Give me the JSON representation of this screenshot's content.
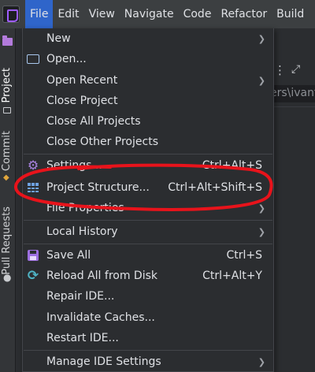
{
  "menubar": {
    "items": [
      "File",
      "Edit",
      "View",
      "Navigate",
      "Code",
      "Refactor",
      "Build"
    ]
  },
  "toolstrip": {
    "project_label": "Project",
    "commit_label": "Commit",
    "pull_requests_label": "Pull Requests"
  },
  "background": {
    "path_fragment": "ers\\ivanf"
  },
  "file_menu": {
    "new": {
      "label": "New",
      "has_submenu": true
    },
    "open": {
      "label": "Open..."
    },
    "open_recent": {
      "label": "Open Recent",
      "has_submenu": true
    },
    "close_project": {
      "label": "Close Project"
    },
    "close_all_projects": {
      "label": "Close All Projects"
    },
    "close_other_projects": {
      "label": "Close Other Projects"
    },
    "settings": {
      "label": "Settings...",
      "shortcut": "Ctrl+Alt+S"
    },
    "project_structure": {
      "label": "Project Structure...",
      "shortcut": "Ctrl+Alt+Shift+S"
    },
    "file_properties": {
      "label": "File Properties",
      "has_submenu": true
    },
    "local_history": {
      "label": "Local History",
      "has_submenu": true
    },
    "save_all": {
      "label": "Save All",
      "shortcut": "Ctrl+S"
    },
    "reload_all": {
      "label": "Reload All from Disk",
      "shortcut": "Ctrl+Alt+Y"
    },
    "repair_ide": {
      "label": "Repair IDE..."
    },
    "invalidate_caches": {
      "label": "Invalidate Caches..."
    },
    "restart_ide": {
      "label": "Restart IDE..."
    },
    "manage_ide_settings": {
      "label": "Manage IDE Settings",
      "has_submenu": true
    }
  },
  "colors": {
    "menu_bg": "#2b2d30",
    "menubar_bg": "#3c3f41",
    "active_menu": "#2f65ca",
    "annotation": "#e8131b"
  }
}
